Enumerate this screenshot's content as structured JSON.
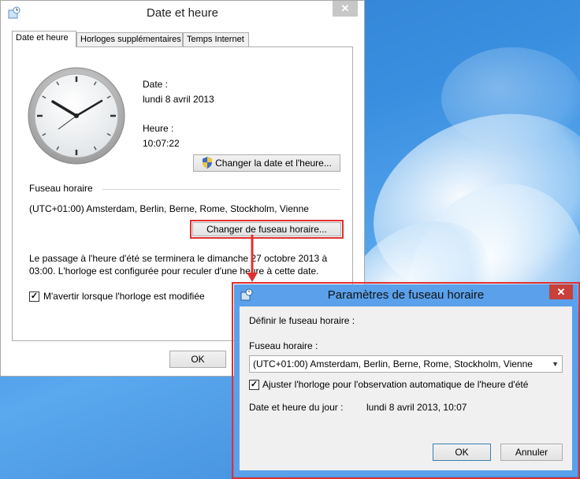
{
  "main_window": {
    "title": "Date et heure",
    "close": "✕",
    "tabs": [
      "Date et heure",
      "Horloges supplémentaires",
      "Temps Internet"
    ],
    "date_label": "Date :",
    "date_value": "lundi 8 avril 2013",
    "time_label": "Heure :",
    "time_value": "10:07:22",
    "change_datetime_button": "Changer la date et l'heure...",
    "timezone_group": "Fuseau horaire",
    "timezone_value": "(UTC+01:00) Amsterdam, Berlin, Berne, Rome, Stockholm, Vienne",
    "change_timezone_button": "Changer de fuseau horaire...",
    "dst_notice_line1": "Le passage à l'heure d'été se terminera le dimanche 27 octobre 2013 à",
    "dst_notice_line2": "03:00. L'horloge est configurée pour reculer d'une heure à cette date.",
    "notify_checkbox_label": "M'avertir lorsque l'horloge est modifiée",
    "notify_checked": true,
    "ok_button": "OK"
  },
  "dialog": {
    "title": "Paramètres de fuseau horaire",
    "close": "✕",
    "heading": "Définir le fuseau horaire :",
    "timezone_label": "Fuseau horaire :",
    "timezone_selected": "(UTC+01:00) Amsterdam, Berlin, Berne, Rome, Stockholm, Vienne",
    "dst_checkbox_label": "Ajuster l'horloge pour l'observation automatique de l'heure d'été",
    "dst_checked": true,
    "current_label": "Date et heure du jour :",
    "current_value": "lundi 8 avril 2013, 10:07",
    "ok_button": "OK",
    "cancel_button": "Annuler"
  },
  "colors": {
    "highlight": "#e03030",
    "dialog_frame": "#5aa0ea"
  }
}
